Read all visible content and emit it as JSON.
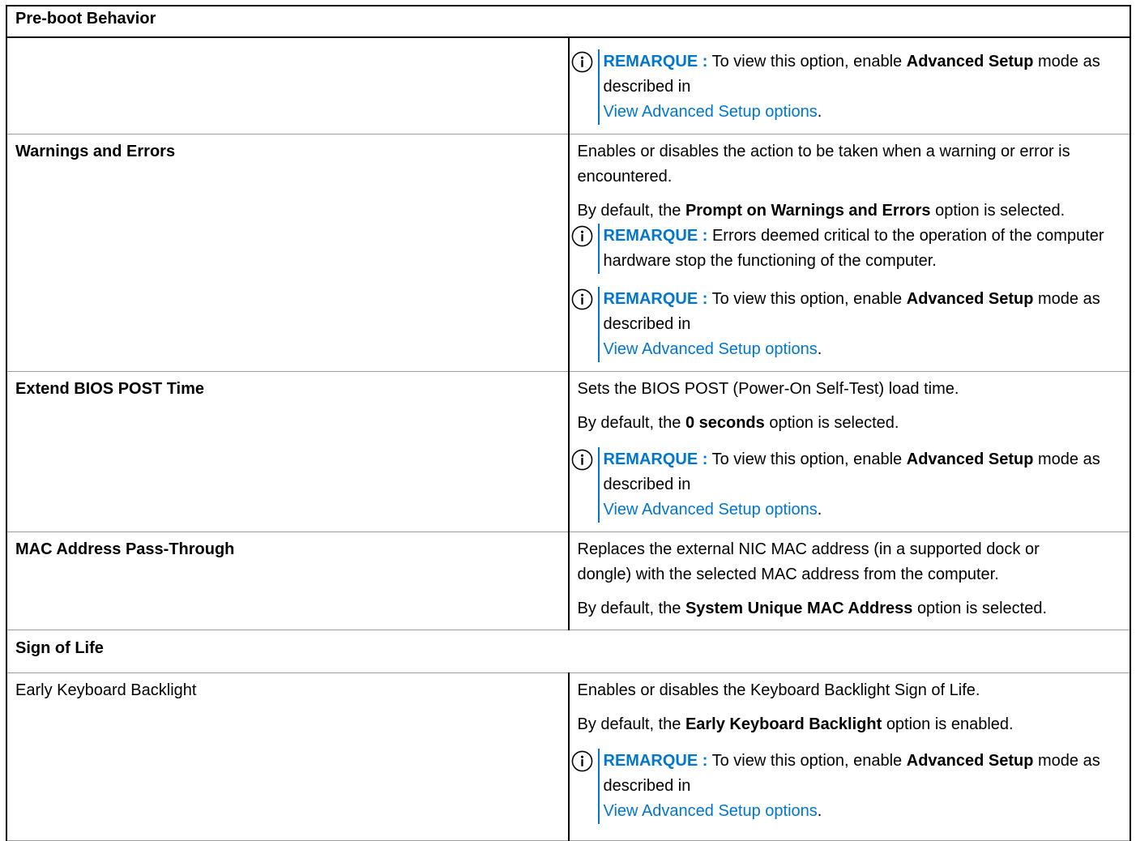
{
  "colors": {
    "note_blue": "#0076ce",
    "border": "#000000",
    "row_divider": "#9c9c9c"
  },
  "note_icon": "info-circle-icon",
  "rows": {
    "preboot": {
      "title": "Pre-boot Behavior",
      "note": {
        "label": "REMARQUE :",
        "text_a": "To view this option, enable",
        "bold": "Advanced Setup",
        "text_b": "mode as described in",
        "link": "View Advanced Setup options",
        "end": "."
      }
    },
    "warnings": {
      "name": "Warnings and Errors",
      "desc": "Enables or disables the action to be taken when a warning or error is encountered.",
      "default_a": "By default, the",
      "default_bold": "Prompt on Warnings and Errors",
      "default_b": "option is selected.",
      "note1": {
        "label": "REMARQUE :",
        "text": "Errors deemed critical to the operation of the computer hardware stop the functioning of the computer."
      },
      "note2": {
        "label": "REMARQUE :",
        "text_a": "To view this option, enable",
        "bold": "Advanced Setup",
        "text_b": "mode as described in",
        "link": "View Advanced Setup options",
        "end": "."
      }
    },
    "extend": {
      "name": "Extend BIOS POST Time",
      "desc": "Sets the BIOS POST (Power-On Self-Test) load time.",
      "default_a": "By default, the",
      "default_bold": "0 seconds",
      "default_b": "option is selected.",
      "note": {
        "label": "REMARQUE :",
        "text_a": "To view this option, enable",
        "bold": "Advanced Setup",
        "text_b": "mode as described in",
        "link": "View Advanced Setup options",
        "end": "."
      }
    },
    "mac": {
      "name": "MAC Address Pass-Through",
      "desc": "Replaces the external NIC MAC address (in a supported dock or dongle) with the selected MAC address from the computer.",
      "default_a": "By default, the",
      "default_bold": "System Unique MAC Address",
      "default_b": "option is selected."
    },
    "sign": {
      "title": "Sign of Life"
    },
    "keyboard": {
      "name": "Early Keyboard Backlight",
      "desc": "Enables or disables the Keyboard Backlight Sign of Life.",
      "default_a": "By default, the",
      "default_bold": "Early Keyboard Backlight",
      "default_b": "option is enabled.",
      "note": {
        "label": "REMARQUE :",
        "text_a": "To view this option, enable",
        "bold": "Advanced Setup",
        "text_b": "mode as described in",
        "link": "View Advanced Setup options",
        "end": "."
      }
    }
  }
}
